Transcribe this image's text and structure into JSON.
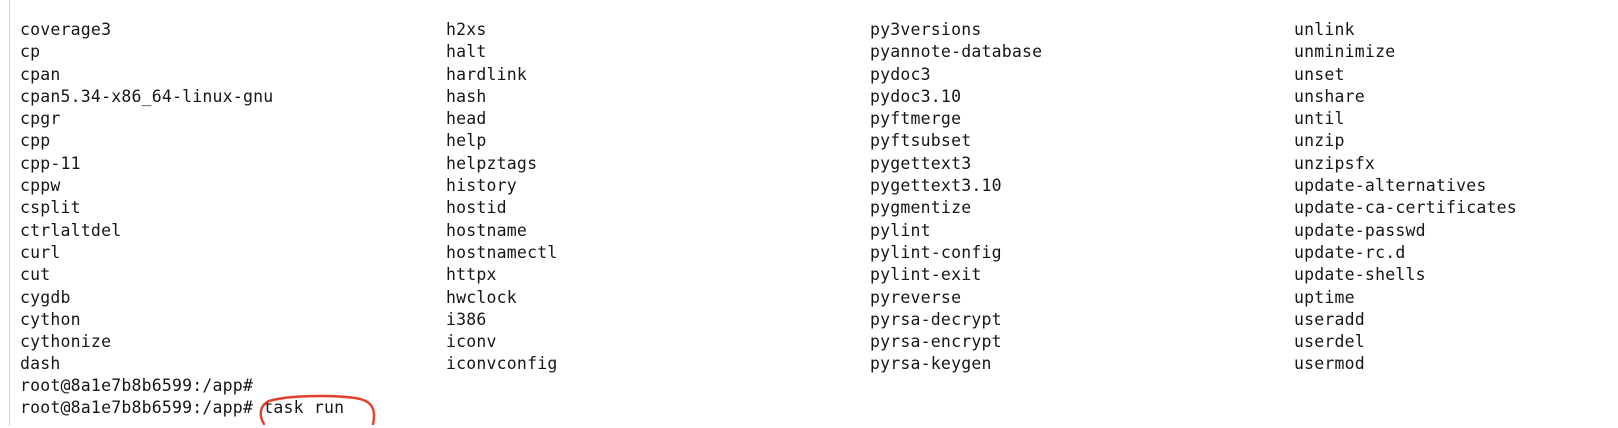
{
  "terminal": {
    "columns": [
      [
        "coverage3",
        "cp",
        "cpan",
        "cpan5.34-x86_64-linux-gnu",
        "cpgr",
        "cpp",
        "cpp-11",
        "cppw",
        "csplit",
        "ctrlaltdel",
        "curl",
        "cut",
        "cygdb",
        "cython",
        "cythonize",
        "dash"
      ],
      [
        "h2xs",
        "halt",
        "hardlink",
        "hash",
        "head",
        "help",
        "helpztags",
        "history",
        "hostid",
        "hostname",
        "hostnamectl",
        "httpx",
        "hwclock",
        "i386",
        "iconv",
        "iconvconfig"
      ],
      [
        "py3versions",
        "pyannote-database",
        "pydoc3",
        "pydoc3.10",
        "pyftmerge",
        "pyftsubset",
        "pygettext3",
        "pygettext3.10",
        "pygmentize",
        "pylint",
        "pylint-config",
        "pylint-exit",
        "pyreverse",
        "pyrsa-decrypt",
        "pyrsa-encrypt",
        "pyrsa-keygen"
      ],
      [
        "unlink",
        "unminimize",
        "unset",
        "unshare",
        "until",
        "unzip",
        "unzipsfx",
        "update-alternatives",
        "update-ca-certificates",
        "update-passwd",
        "update-rc.d",
        "update-shells",
        "uptime",
        "useradd",
        "userdel",
        "usermod"
      ]
    ],
    "prompt_lines": [
      {
        "prompt": "root@8a1e7b8b6599:/app# ",
        "command": ""
      },
      {
        "prompt": "root@8a1e7b8b6599:/app# ",
        "command": "task run"
      }
    ],
    "annotation_color": "#e0412d"
  }
}
